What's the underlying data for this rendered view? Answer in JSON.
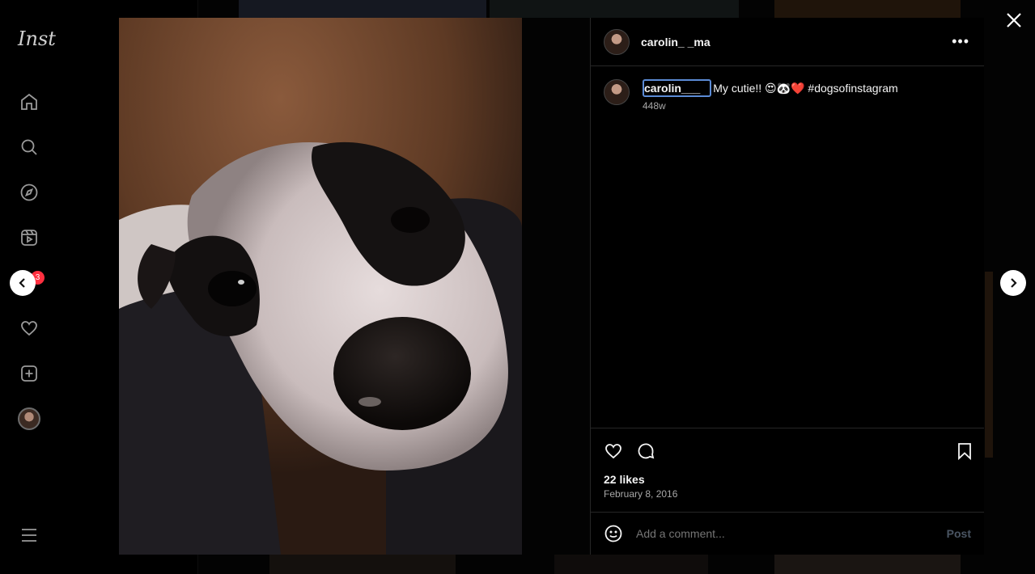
{
  "sidebar": {
    "logo": "Inst",
    "notification_count": "3",
    "items": [
      {
        "icon": "home-icon"
      },
      {
        "icon": "search-icon"
      },
      {
        "icon": "explore-icon"
      },
      {
        "icon": "reels-icon"
      },
      {
        "icon": "messages-icon"
      },
      {
        "icon": "heart-icon"
      },
      {
        "icon": "create-icon"
      },
      {
        "icon": "profile-avatar"
      },
      {
        "icon": "menu-icon"
      }
    ]
  },
  "post": {
    "username": "carolin_  _ma",
    "caption_user": "carolin___",
    "caption": "My cutie!! 😍🐼❤️ #dogsofinstagram",
    "age": "448w",
    "likes": "22 likes",
    "date": "February 8, 2016",
    "comment_placeholder": "Add a comment...",
    "post_label": "Post"
  },
  "colors": {
    "background": "#000000",
    "text": "#f5f5f5",
    "muted": "#a8a8a8",
    "badge": "#ff3040",
    "caption_focus": "#5b8bd6"
  }
}
